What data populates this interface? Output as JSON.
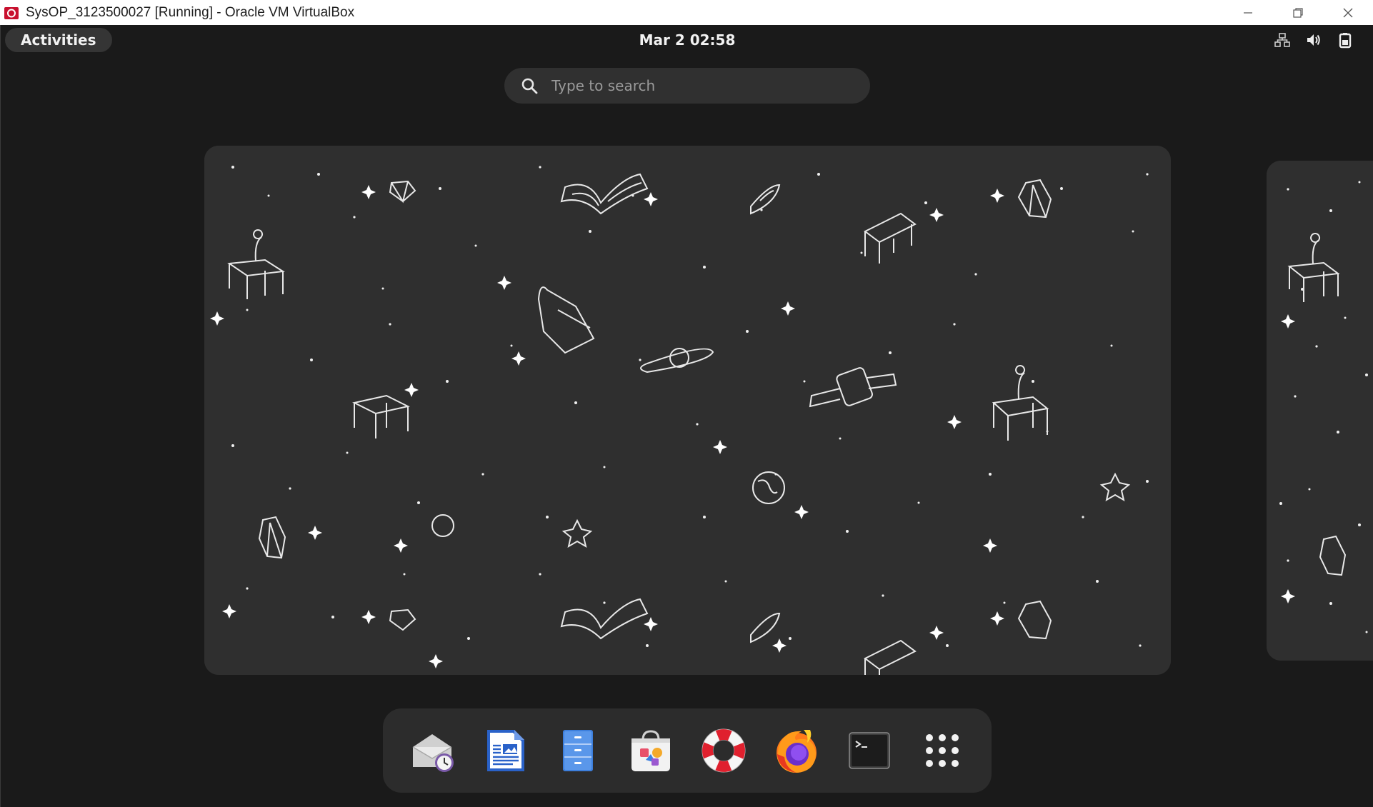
{
  "window": {
    "title": "SysOP_3123500027 [Running] - Oracle VM VirtualBox",
    "controls": [
      "minimize-icon",
      "restore-icon",
      "close-icon"
    ]
  },
  "topbar": {
    "activities_label": "Activities",
    "clock": "Mar 2  02:58",
    "tray_icons": [
      "network-icon",
      "volume-icon",
      "battery-icon"
    ]
  },
  "search": {
    "placeholder": "Type to search"
  },
  "dock": {
    "apps": [
      {
        "name": "evolution-mail",
        "icon": "mail-clock-icon"
      },
      {
        "name": "libreoffice-writer",
        "icon": "writer-icon"
      },
      {
        "name": "files",
        "icon": "files-cabinet-icon"
      },
      {
        "name": "software",
        "icon": "software-bag-icon"
      },
      {
        "name": "help",
        "icon": "lifebuoy-icon"
      },
      {
        "name": "firefox",
        "icon": "firefox-icon"
      },
      {
        "name": "terminal",
        "icon": "terminal-icon"
      },
      {
        "name": "show-apps",
        "icon": "app-grid-icon"
      }
    ]
  },
  "colors": {
    "background": "#1a1a1a",
    "wallpaper": "#2f2f2f",
    "dock": "#2c2c2c",
    "search": "#303030",
    "vbox_red": "#c8102e"
  }
}
